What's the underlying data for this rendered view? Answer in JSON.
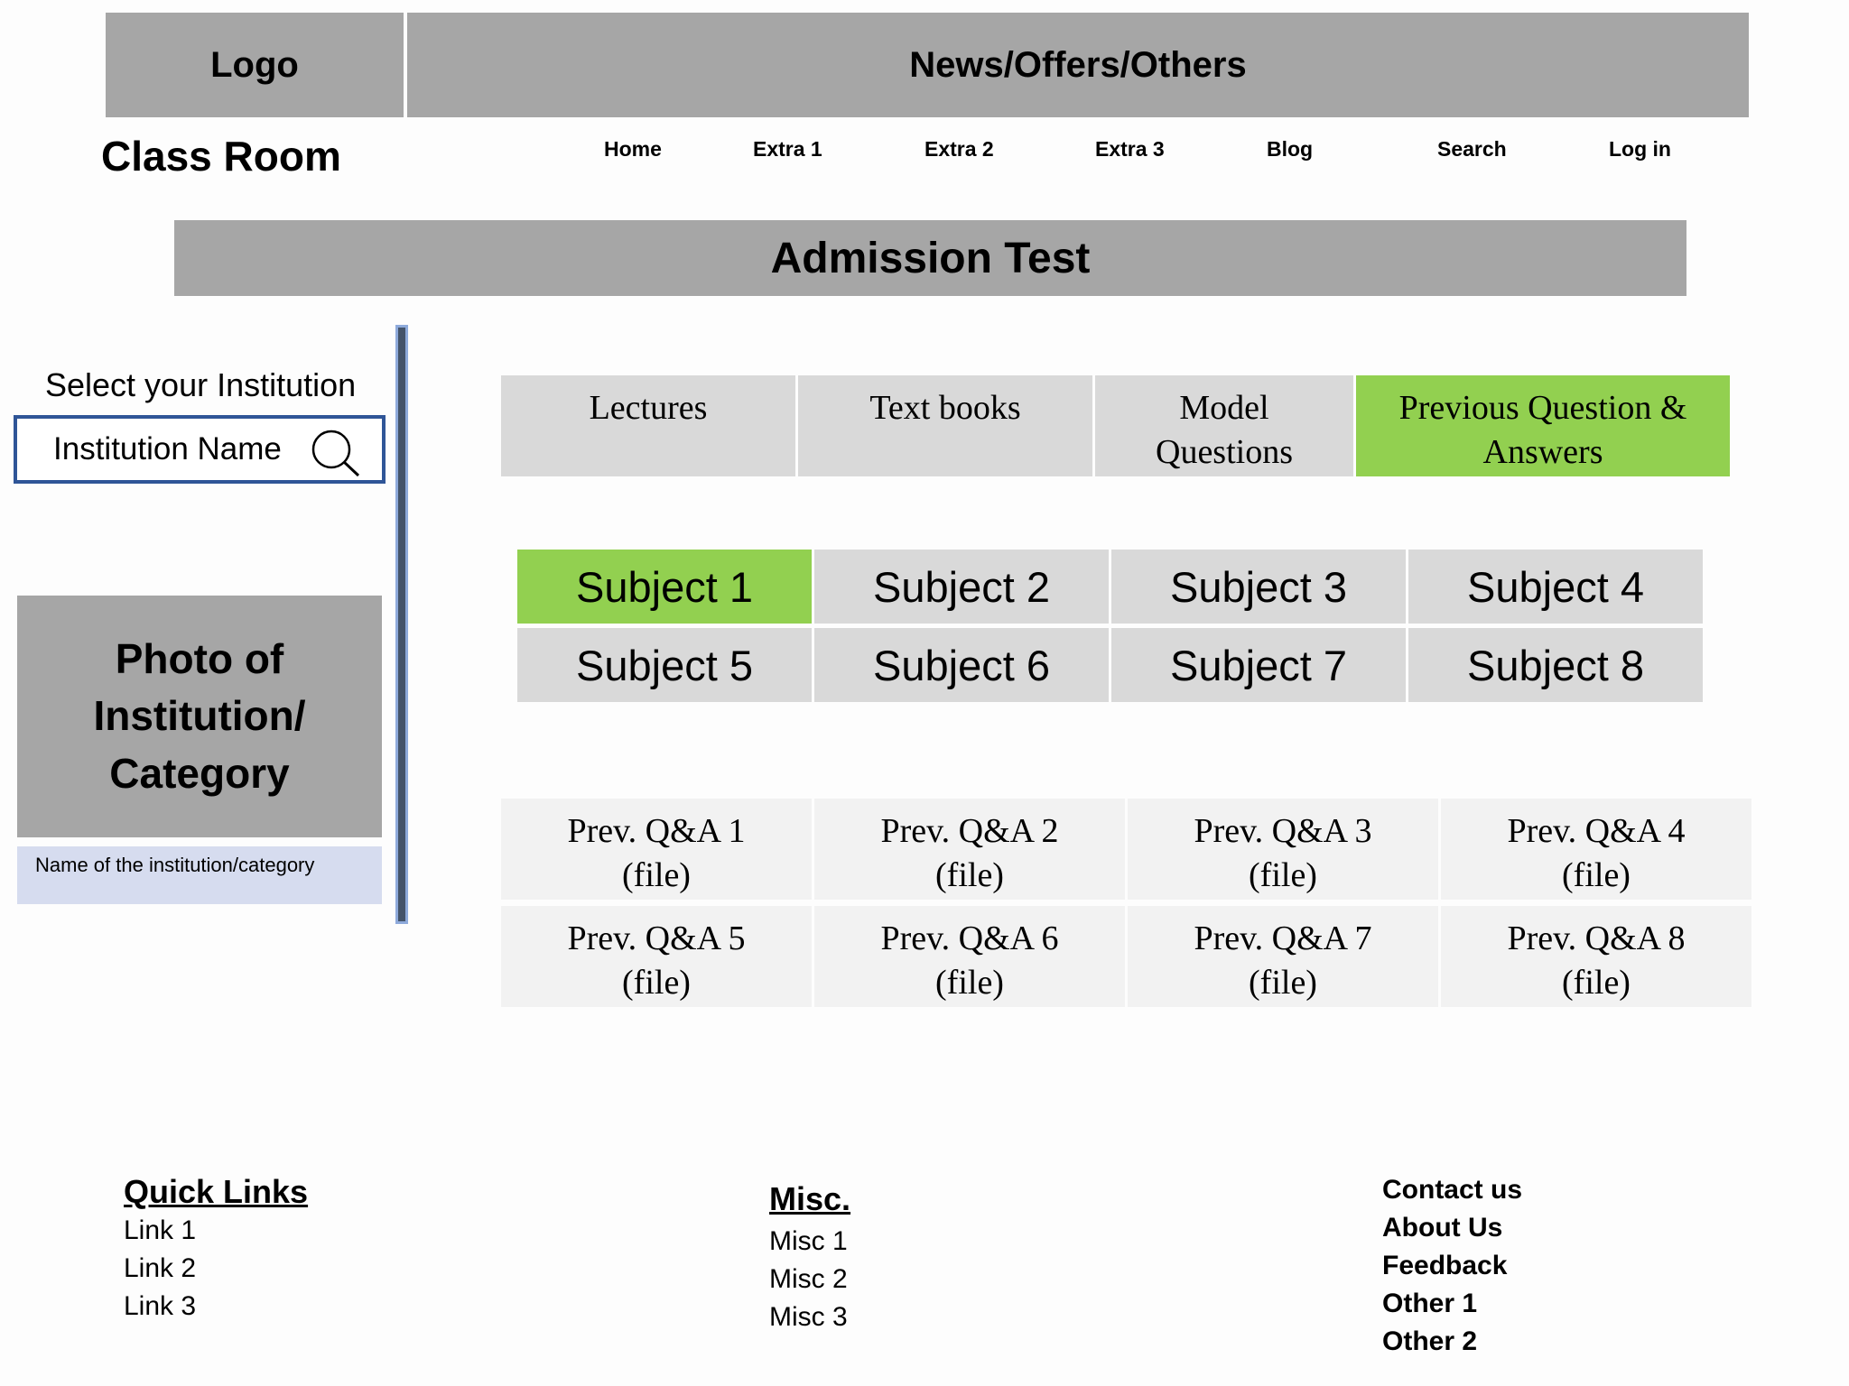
{
  "header": {
    "logo_label": "Logo",
    "news_label": "News/Offers/Others",
    "site_title": "Class Room"
  },
  "nav": {
    "items": [
      "Home",
      "Extra 1",
      "Extra 2",
      "Extra 3",
      "Blog",
      "Search",
      "Log in"
    ]
  },
  "page": {
    "banner": "Admission Test"
  },
  "sidebar": {
    "select_label": "Select your Institution",
    "search_placeholder": "Institution Name",
    "search_icon": "search-icon",
    "photo_text": "Photo of Institution/ Category",
    "caption": "Name of the institution/category"
  },
  "tabs": [
    {
      "label": "Lectures",
      "active": false
    },
    {
      "label": "Text books",
      "active": false
    },
    {
      "label": "Model Questions",
      "active": false
    },
    {
      "label": "Previous Question & Answers",
      "active": true
    }
  ],
  "subjects": [
    {
      "label": "Subject 1",
      "active": true
    },
    {
      "label": "Subject 2",
      "active": false
    },
    {
      "label": "Subject 3",
      "active": false
    },
    {
      "label": "Subject 4",
      "active": false
    },
    {
      "label": "Subject 5",
      "active": false
    },
    {
      "label": "Subject 6",
      "active": false
    },
    {
      "label": "Subject 7",
      "active": false
    },
    {
      "label": "Subject 8",
      "active": false
    }
  ],
  "qa_files": [
    {
      "title": "Prev. Q&A 1",
      "type": "(file)"
    },
    {
      "title": "Prev. Q&A 2",
      "type": "(file)"
    },
    {
      "title": "Prev. Q&A 3",
      "type": "(file)"
    },
    {
      "title": "Prev. Q&A 4",
      "type": "(file)"
    },
    {
      "title": "Prev. Q&A 5",
      "type": "(file)"
    },
    {
      "title": "Prev. Q&A 6",
      "type": "(file)"
    },
    {
      "title": "Prev. Q&A 7",
      "type": "(file)"
    },
    {
      "title": "Prev. Q&A 8",
      "type": "(file)"
    }
  ],
  "footer": {
    "quick_links": {
      "heading": "Quick Links",
      "items": [
        "Link 1",
        "Link 2",
        "Link 3"
      ]
    },
    "misc": {
      "heading": "Misc.",
      "items": [
        "Misc 1",
        "Misc 2",
        "Misc 3"
      ]
    },
    "contact": {
      "items": [
        "Contact us",
        "About Us",
        "Feedback",
        "Other 1",
        "Other 2"
      ]
    }
  },
  "colors": {
    "bar_gray": "#a6a6a6",
    "cell_gray": "#d9d9d9",
    "active_green": "#92d050",
    "accent_blue": "#2f5597",
    "caption_bg": "#d6dcef"
  }
}
